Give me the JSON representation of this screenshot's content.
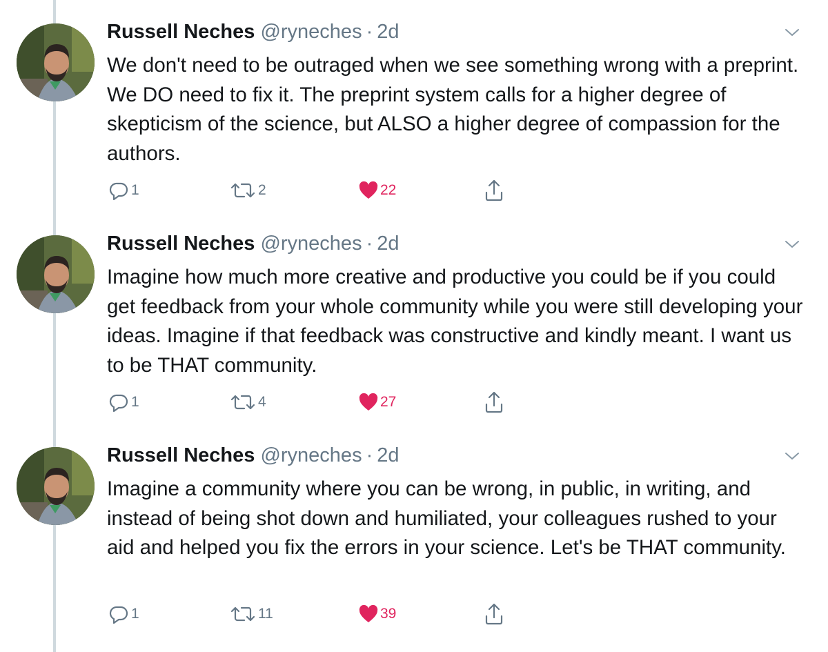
{
  "tweets": [
    {
      "name": "Russell Neches",
      "handle": "@ryneches",
      "separator": "·",
      "time": "2d",
      "text": "We don't need to be outraged when we see something wrong with a preprint. We DO need to fix it. The preprint system calls for a higher degree of skepticism of the science, but ALSO a higher degree of compassion for the authors.",
      "replies": "1",
      "retweets": "2",
      "likes": "22",
      "liked": true
    },
    {
      "name": "Russell Neches",
      "handle": "@ryneches",
      "separator": "·",
      "time": "2d",
      "text": "Imagine how much more creative and productive you could be if you could get feedback from your whole community while you were still developing your ideas. Imagine if that feedback was constructive and kindly meant. I want us to be THAT community.",
      "replies": "1",
      "retweets": "4",
      "likes": "27",
      "liked": true
    },
    {
      "name": "Russell Neches",
      "handle": "@ryneches",
      "separator": "·",
      "time": "2d",
      "text": "Imagine a community where you can be wrong, in public, in writing, and instead of being shot down and humiliated, your colleagues rushed to your aid and helped you fix the errors in your science. Let's be THAT community.",
      "replies": "1",
      "retweets": "11",
      "likes": "39",
      "liked": true
    }
  ],
  "icons": {
    "reply": "reply-icon",
    "retweet": "retweet-icon",
    "like": "heart-icon",
    "share": "share-icon",
    "menu": "chevron-down-icon"
  },
  "colors": {
    "text": "#14171a",
    "secondary": "#657786",
    "like": "#e0245e",
    "thread_line": "#cfd9de"
  }
}
